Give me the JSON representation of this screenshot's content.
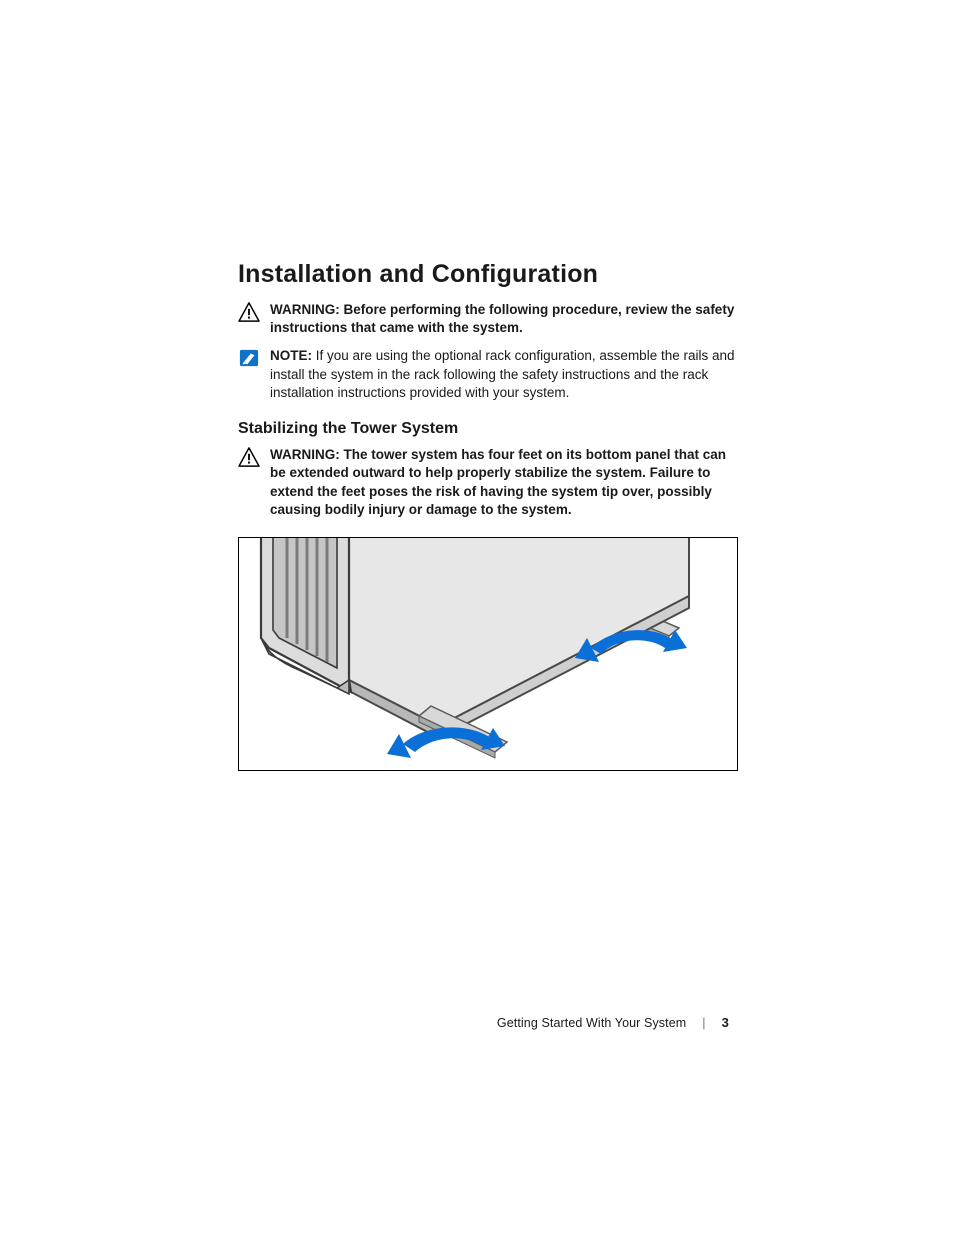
{
  "heading": "Installation and Configuration",
  "warning1": {
    "label": "WARNING:",
    "text": " Before performing the following procedure, review the safety instructions that came with the system."
  },
  "note1": {
    "label": "NOTE:",
    "text": " If you are using the optional rack configuration, assemble the rails and install the system in the rack following the safety instructions and the rack installation instructions provided with your system."
  },
  "subheading": "Stabilizing the Tower System",
  "warning2": {
    "label": "WARNING:",
    "text": " The tower system has four feet on its bottom panel that can be extended outward to help properly stabilize the system. Failure to extend the feet poses the risk of having the system tip over, possibly causing bodily injury or damage to the system."
  },
  "footer": {
    "title": "Getting Started With Your System",
    "page": "3"
  }
}
